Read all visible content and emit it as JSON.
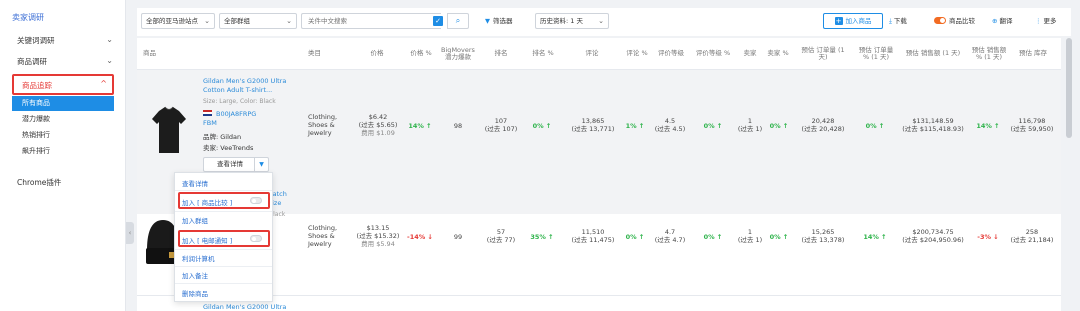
{
  "sidebar": {
    "title": "卖家调研",
    "items": [
      {
        "label": "关键词调研",
        "chev": "⌄"
      },
      {
        "label": "商品调研",
        "chev": "⌄"
      }
    ],
    "active": {
      "label": "商品追踪",
      "chev": "^"
    },
    "subitems": [
      "所有商品",
      "潜力爆款",
      "热销排行",
      "飙升排行"
    ],
    "chrome": "Chrome插件"
  },
  "toolbar": {
    "site_select": "全部的亚马逊站点",
    "group_select": "全部群组",
    "keyword_placeholder": "关件中文搜索",
    "filter_label": "筛选器",
    "history_select": "历史资料: 1 天",
    "add_product": "加入商品",
    "download": "下载",
    "compare": "商品比较",
    "translate": "翻译",
    "more": "更多"
  },
  "table": {
    "headers": [
      "商品",
      "类目",
      "价格",
      "价格 %",
      "BigMovers 潜力爆款",
      "排名",
      "排名 %",
      "评论",
      "评论 %",
      "评价等级",
      "评价等级 %",
      "卖家",
      "卖家 %",
      "预估 订单量 (1 天)",
      "预估 订单量 % (1 天)",
      "预估 销售额 (1 天)",
      "预估 销售额 % (1 天)",
      "预估 库存"
    ],
    "rows": [
      {
        "name_line1": "Gildan Men's G2000 Ultra",
        "name_line2": "Cotton Adult T-shirt...",
        "meta": "Size: Large, Color: Black",
        "asin": "B00JA8FRPG",
        "asin_tail": "FBM",
        "brand": "品牌: Gildan",
        "seller": "卖家: VeeTrends",
        "view": "查看详情",
        "category": [
          "Clothing,",
          "Shoes &",
          "Jewelry"
        ],
        "price": "$6.42",
        "price_past": "(过去 $5.65)",
        "fee": "费用 $1.09",
        "price_pct": "14% ↑",
        "bigmovers": "98",
        "rank": "107",
        "rank_past": "(过去 107)",
        "rank_pct": "0% ↑",
        "reviews": "13,865",
        "reviews_past": "(过去 13,771)",
        "reviews_pct": "1% ↑",
        "rating": "4.5",
        "rating_past": "(过去 4.5)",
        "rating_pct": "0% ↑",
        "sellers": "1",
        "sellers_past": "(过去 1)",
        "sellers_pct": "0% ↑",
        "orders": "20,428",
        "orders_past": "(过去 20,428)",
        "orders_pct": "0% ↑",
        "sales": "$131,148.59",
        "sales_past": "(过去 $115,418.93)",
        "sales_pct": "14% ↑",
        "stock": "116,798",
        "stock_past": "(过去 59,950)"
      },
      {
        "name_line1": "c Watch",
        "name_line2": "Size",
        "meta": "Black",
        "category": [
          "Clothing,",
          "Shoes &",
          "Jewelry"
        ],
        "price": "$13.15",
        "price_past": "(过去 $15.32)",
        "fee": "费用 $5.94",
        "price_pct": "-14% ↓",
        "bigmovers": "99",
        "rank": "57",
        "rank_past": "(过去 77)",
        "rank_pct": "35% ↑",
        "reviews": "11,510",
        "reviews_past": "(过去 11,475)",
        "reviews_pct": "0% ↑",
        "rating": "4.7",
        "rating_past": "(过去 4.7)",
        "rating_pct": "0% ↑",
        "sellers": "1",
        "sellers_past": "(过去 1)",
        "sellers_pct": "0% ↑",
        "orders": "15,265",
        "orders_past": "(过去 13,378)",
        "orders_pct": "14% ↑",
        "sales": "$200,734.75",
        "sales_past": "(过去 $204,950.96)",
        "sales_pct": "-3% ↓",
        "stock": "258",
        "stock_past": "(过去 21,184)"
      }
    ],
    "next_row_name": "Gildan Men's G2000 Ultra"
  },
  "dropdown": {
    "items": [
      "查看详情",
      "加入 [ 商品比较 ]",
      "加入群组",
      "加入 [ 电邮通知 ]",
      "利润计算机",
      "加入备注",
      "删除商品"
    ]
  },
  "colors": {
    "accent": "#1e8de5",
    "highlight_red": "#e53935",
    "positive": "#2db34a",
    "toggle_orange": "#f26b22"
  }
}
